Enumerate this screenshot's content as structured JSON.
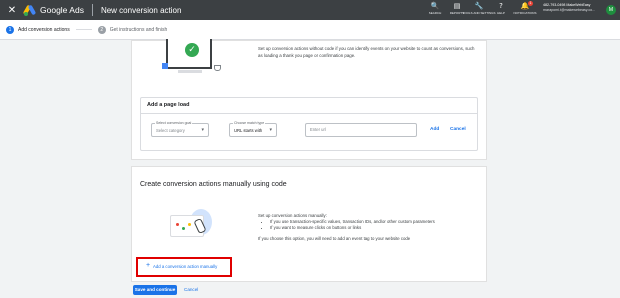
{
  "topbar": {
    "close_glyph": "✕",
    "app_name": "Google Ads",
    "page_title": "New conversion action",
    "tools": [
      {
        "icon": "search-icon",
        "glyph": "🔍",
        "label": "SEARCH"
      },
      {
        "icon": "reports-icon",
        "glyph": "▤",
        "label": "REPORTS"
      },
      {
        "icon": "wrench-icon",
        "glyph": "🔧",
        "label": "TOOLS AND SETTINGS"
      },
      {
        "icon": "help-icon",
        "glyph": "?",
        "label": "HELP"
      },
      {
        "icon": "bell-icon",
        "glyph": "🔔",
        "label": "NOTIFICATIONS",
        "count": "1"
      }
    ],
    "account": {
      "id_name": "482-793-0498 MakeWebEasy",
      "email": "marapomi.t@makewebeasy.co..."
    },
    "avatar_letter": "M"
  },
  "stepper": {
    "steps": [
      {
        "num": "1",
        "label": "Add conversion actions"
      },
      {
        "num": "2",
        "label": "Get instructions and finish"
      }
    ]
  },
  "page_load_card": {
    "description": "Set up conversion actions without code if you can identify events on your website to count as conversions, such as loading a thank you page or confirmation page.",
    "section_title": "Add a page load",
    "goal_select": {
      "caption": "Select conversion goal",
      "value": "Select category"
    },
    "match_select": {
      "caption": "Choose match type",
      "value": "URL starts with"
    },
    "url_input": {
      "placeholder": "Enter url"
    },
    "add_label": "Add",
    "cancel_label": "Cancel"
  },
  "manual_card": {
    "title": "Create conversion actions manually using code",
    "intro": "Set up conversion actions manually:",
    "bullets": [
      "If you use transaction-specific values, transaction IDs, and/or other custom parameters",
      "If you want to measure clicks on buttons or links"
    ],
    "note": "If you choose this option, you will need to add an event tag to your website code",
    "add_manual_label": "Add a conversion action manually",
    "plus_glyph": "+"
  },
  "footer": {
    "save_label": "Save and continue",
    "cancel_label": "Cancel"
  },
  "colors": {
    "topbar": "#3c4043",
    "accent": "#1a73e8",
    "highlight_box": "#e00000",
    "success": "#34a853"
  }
}
